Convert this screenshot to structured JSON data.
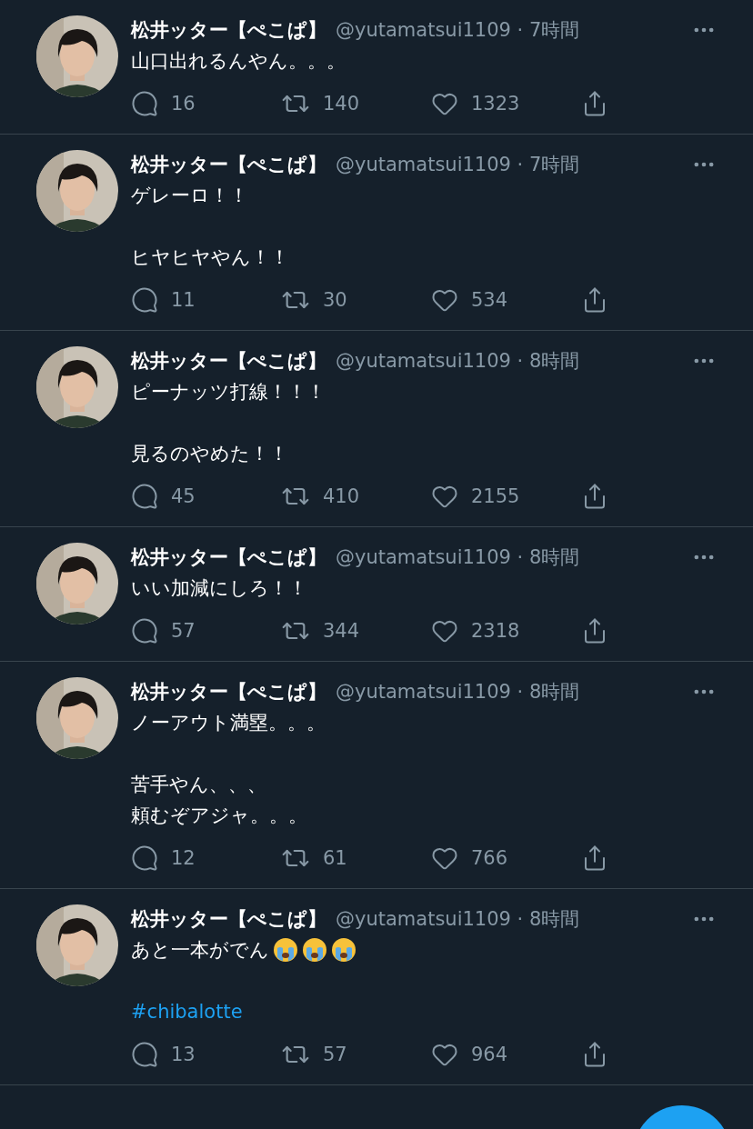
{
  "tweets": [
    {
      "name": "松井ッター【ぺこぱ】",
      "meta": "@yutamatsui1109 · 7時間",
      "paragraphs": [
        [
          [
            {
              "kind": "text",
              "text": "山口出れるんやん。。。"
            }
          ]
        ]
      ],
      "replies": "16",
      "retweets": "140",
      "likes": "1323"
    },
    {
      "name": "松井ッター【ぺこぱ】",
      "meta": "@yutamatsui1109 · 7時間",
      "paragraphs": [
        [
          [
            {
              "kind": "text",
              "text": "ゲレーロ！！"
            }
          ]
        ],
        [
          [
            {
              "kind": "text",
              "text": "ヒヤヒヤやん！！"
            }
          ]
        ]
      ],
      "replies": "11",
      "retweets": "30",
      "likes": "534"
    },
    {
      "name": "松井ッター【ぺこぱ】",
      "meta": "@yutamatsui1109 · 8時間",
      "paragraphs": [
        [
          [
            {
              "kind": "text",
              "text": "ピーナッツ打線！！！"
            }
          ]
        ],
        [
          [
            {
              "kind": "text",
              "text": "見るのやめた！！"
            }
          ]
        ]
      ],
      "replies": "45",
      "retweets": "410",
      "likes": "2155"
    },
    {
      "name": "松井ッター【ぺこぱ】",
      "meta": "@yutamatsui1109 · 8時間",
      "paragraphs": [
        [
          [
            {
              "kind": "text",
              "text": "いい加減にしろ！！"
            }
          ]
        ]
      ],
      "replies": "57",
      "retweets": "344",
      "likes": "2318"
    },
    {
      "name": "松井ッター【ぺこぱ】",
      "meta": "@yutamatsui1109 · 8時間",
      "paragraphs": [
        [
          [
            {
              "kind": "text",
              "text": "ノーアウト満塁。。。"
            }
          ]
        ],
        [
          [
            {
              "kind": "text",
              "text": "苦手やん、、、"
            }
          ],
          [
            {
              "kind": "text",
              "text": "頼むぞアジャ。。。"
            }
          ]
        ]
      ],
      "replies": "12",
      "retweets": "61",
      "likes": "766"
    },
    {
      "name": "松井ッター【ぺこぱ】",
      "meta": "@yutamatsui1109 · 8時間",
      "paragraphs": [
        [
          [
            {
              "kind": "text",
              "text": "あと一本がでん"
            },
            {
              "kind": "emoji"
            },
            {
              "kind": "emoji"
            },
            {
              "kind": "emoji"
            }
          ]
        ],
        [
          [
            {
              "kind": "hashtag",
              "text": "#chibalotte"
            }
          ]
        ]
      ],
      "replies": "13",
      "retweets": "57",
      "likes": "964"
    }
  ]
}
